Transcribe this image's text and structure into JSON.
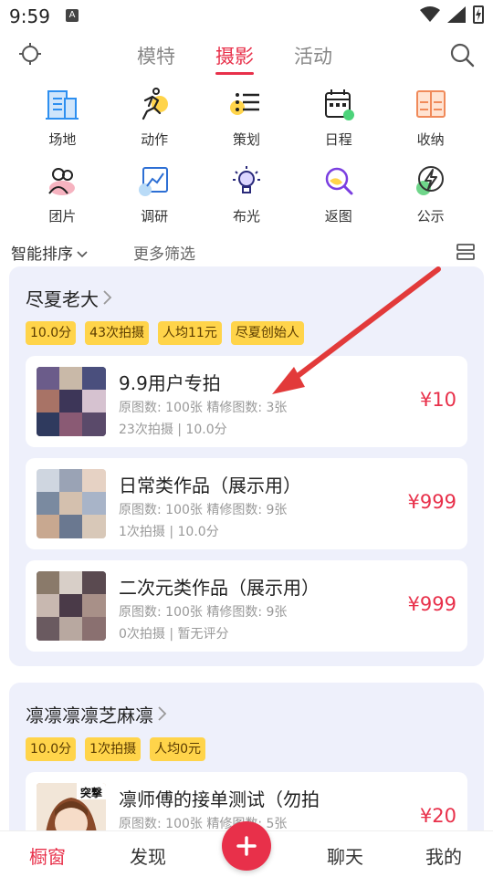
{
  "status": {
    "time": "9:59",
    "badge": "A"
  },
  "topnav": {
    "tabs": [
      "模特",
      "摄影",
      "活动"
    ],
    "active_index": 1
  },
  "categories": [
    {
      "label": "场地",
      "icon": "building-icon"
    },
    {
      "label": "动作",
      "icon": "running-icon"
    },
    {
      "label": "策划",
      "icon": "list-icon"
    },
    {
      "label": "日程",
      "icon": "calendar-icon"
    },
    {
      "label": "收纳",
      "icon": "cabinet-icon"
    },
    {
      "label": "团片",
      "icon": "group-icon"
    },
    {
      "label": "调研",
      "icon": "chart-icon"
    },
    {
      "label": "布光",
      "icon": "bulb-icon"
    },
    {
      "label": "返图",
      "icon": "search-image-icon"
    },
    {
      "label": "公示",
      "icon": "lightning-icon"
    }
  ],
  "sortbar": {
    "sort_label": "智能排序",
    "more_label": "更多筛选"
  },
  "shops": [
    {
      "name": "尽夏老大",
      "tags": [
        "10.0分",
        "43次拍摄",
        "人均11元",
        "尽夏创始人"
      ],
      "items": [
        {
          "name": "9.9用户专拍",
          "meta": "原图数: 100张   精修图数: 3张",
          "stat": "23次拍摄 | 10.0分",
          "price": "¥10"
        },
        {
          "name": "日常类作品（展示用）",
          "meta": "原图数: 100张   精修图数: 9张",
          "stat": "1次拍摄 | 10.0分",
          "price": "¥999"
        },
        {
          "name": "二次元类作品（展示用）",
          "meta": "原图数: 100张   精修图数: 9张",
          "stat": "0次拍摄 | 暂无评分",
          "price": "¥999"
        }
      ]
    },
    {
      "name": "凛凛凛凛芝麻凛",
      "tags": [
        "10.0分",
        "1次拍摄",
        "人均0元"
      ],
      "items": [
        {
          "name": "凛师傅的接单测试（勿拍",
          "meta": "原图数: 100张   精修图数: 5张",
          "stat": "",
          "price": "¥20",
          "thumb_text": "突撃"
        }
      ]
    }
  ],
  "tabbar": {
    "items": [
      "橱窗",
      "发现",
      "聊天",
      "我的"
    ],
    "active_index": 0
  },
  "colors": {
    "accent": "#e8304a",
    "tag": "#ffd44a",
    "card_bg": "#eef0fb"
  }
}
